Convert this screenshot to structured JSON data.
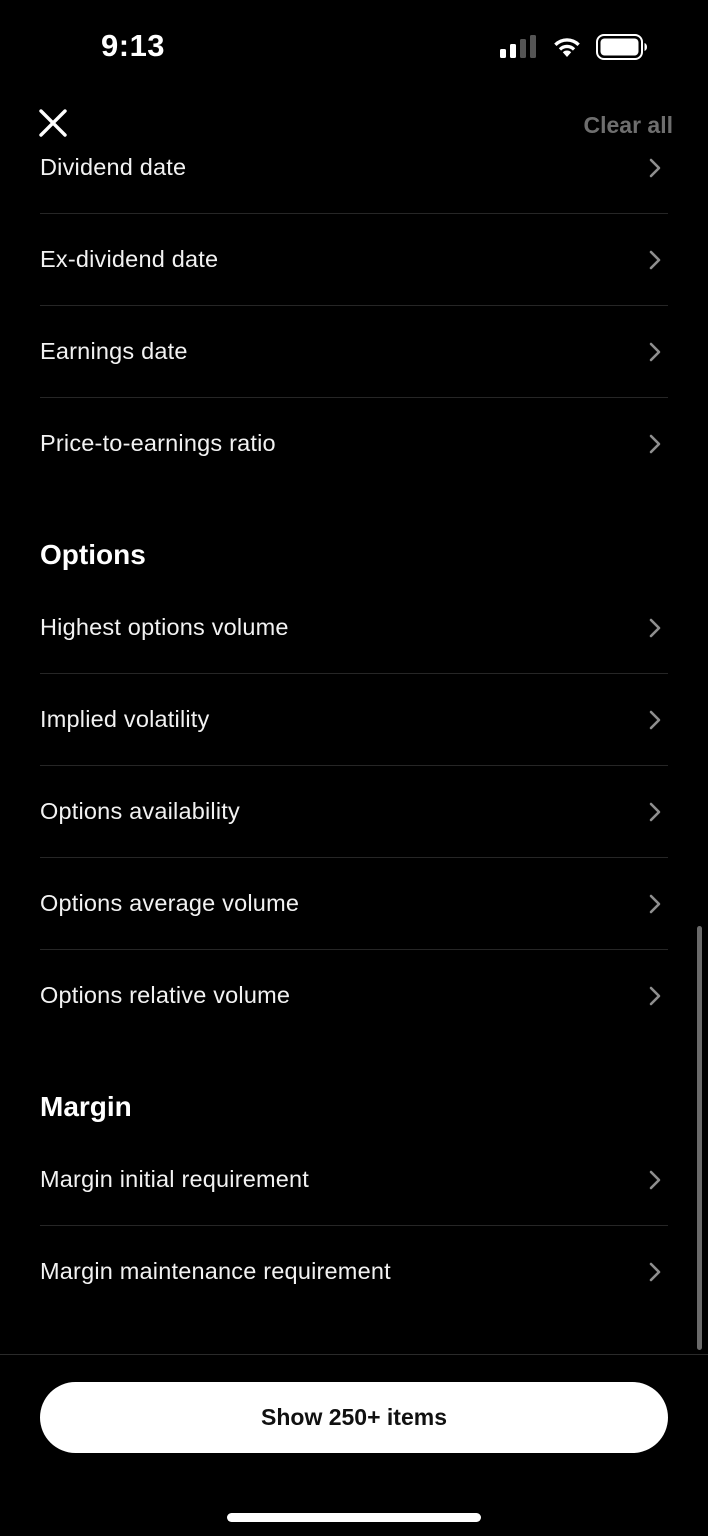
{
  "status_bar": {
    "time": "9:13"
  },
  "header": {
    "close_icon": "close-icon",
    "clear_all_label": "Clear all"
  },
  "list": {
    "top_items": [
      {
        "label": "Dividend date"
      },
      {
        "label": "Ex-dividend date"
      },
      {
        "label": "Earnings date"
      },
      {
        "label": "Price-to-earnings ratio"
      }
    ],
    "sections": [
      {
        "title": "Options",
        "items": [
          {
            "label": "Highest options volume"
          },
          {
            "label": "Implied volatility"
          },
          {
            "label": "Options availability"
          },
          {
            "label": "Options average volume"
          },
          {
            "label": "Options relative volume"
          }
        ]
      },
      {
        "title": "Margin",
        "items": [
          {
            "label": "Margin initial requirement"
          },
          {
            "label": "Margin maintenance requirement"
          }
        ]
      }
    ]
  },
  "footer": {
    "show_button_label": "Show 250+ items"
  },
  "icons": {
    "row_chevron": "chevron-right-icon"
  },
  "colors": {
    "background": "#000000",
    "primary_text": "#ffffff",
    "muted_text": "#6e6e6e",
    "button_bg": "#ffffff",
    "button_text": "#111111"
  }
}
